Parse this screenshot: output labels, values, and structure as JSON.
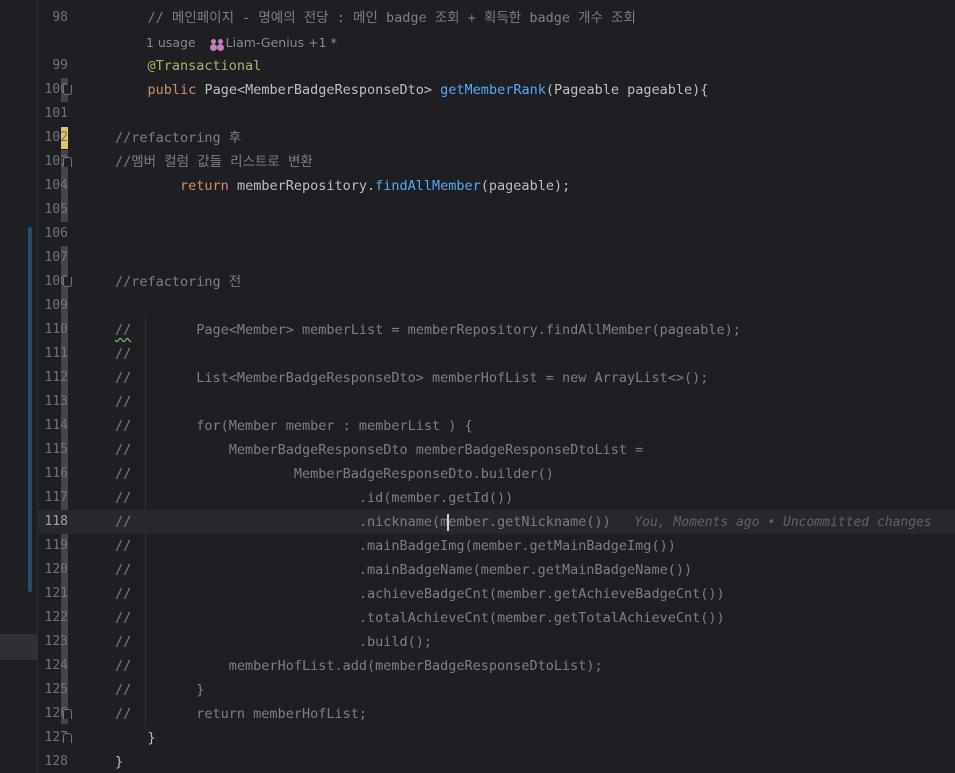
{
  "editor": {
    "lines": [
      {
        "num": "98",
        "text": "    // 메인페이지 - 명예의 전당 : 메인 badge 조회 + 획득한 badge 개수 조회"
      },
      {
        "num": "",
        "hint_usage": "1 usage",
        "hint_author": "Liam-Genius +1 *"
      },
      {
        "num": "99",
        "text": "    @Transactional"
      },
      {
        "num": "100",
        "parts": [
          "    ",
          "public",
          " ",
          "Page",
          "<",
          "MemberBadgeResponseDto",
          "> ",
          "getMemberRank",
          "(",
          "Pageable",
          " pageable){"
        ]
      },
      {
        "num": "101",
        "text": ""
      },
      {
        "num": "102",
        "text": "//refactoring 후"
      },
      {
        "num": "103",
        "text": "//멤버 컬럼 값들 리스트로 변환"
      },
      {
        "num": "104",
        "parts": [
          "        ",
          "return",
          " memberRepository.",
          "findAllMember",
          "(pageable);"
        ]
      },
      {
        "num": "105",
        "text": ""
      },
      {
        "num": "106",
        "text": ""
      },
      {
        "num": "107",
        "text": ""
      },
      {
        "num": "108",
        "text": "//refactoring 전"
      },
      {
        "num": "109",
        "text": ""
      },
      {
        "num": "110",
        "text": "        Page<Member> memberList = memberRepository.findAllMember(pageable);"
      },
      {
        "num": "111",
        "text": ""
      },
      {
        "num": "112",
        "text": "        List<MemberBadgeResponseDto> memberHofList = new ArrayList<>();"
      },
      {
        "num": "113",
        "text": ""
      },
      {
        "num": "114",
        "text": "        for(Member member : memberList ) {"
      },
      {
        "num": "115",
        "text": "            MemberBadgeResponseDto memberBadgeResponseDtoList ="
      },
      {
        "num": "116",
        "text": "                    MemberBadgeResponseDto.builder()"
      },
      {
        "num": "117",
        "text": "                            .id(member.getId())"
      },
      {
        "num": "118",
        "text_before_caret": "                            .nickname(m",
        "text_after_caret": "ember.getNickname())",
        "blame": "   You, Moments ago • Uncommitted changes"
      },
      {
        "num": "119",
        "text": "                            .mainBadgeImg(member.getMainBadgeImg())"
      },
      {
        "num": "120",
        "text": "                            .mainBadgeName(member.getMainBadgeName())"
      },
      {
        "num": "121",
        "text": "                            .achieveBadgeCnt(member.getAchieveBadgeCnt())"
      },
      {
        "num": "122",
        "text": "                            .totalAchieveCnt(member.getTotalAchieveCnt())"
      },
      {
        "num": "123",
        "text": "                            .build();"
      },
      {
        "num": "124",
        "text": "            memberHofList.add(memberBadgeResponseDtoList);"
      },
      {
        "num": "125",
        "text": "        }"
      },
      {
        "num": "126",
        "text": "        return memberHofList;"
      },
      {
        "num": "127",
        "text": "    }"
      },
      {
        "num": "128",
        "text": "}"
      }
    ],
    "comment_prefix": "//",
    "colors": {
      "background": "#1e1f22",
      "current_line": "#26282e",
      "keyword": "#cf8e6d",
      "annotation": "#b3ae60",
      "function": "#56a8f5",
      "comment": "#7a7e85",
      "text": "#bcbec4",
      "line_number": "#6f737a",
      "changed_bar_yellow": "#e0c46c",
      "changed_bar_gray": "#43454a",
      "author_icon": "#c77dba"
    },
    "icons": [
      "fold-marker-icon",
      "users-icon",
      "text-caret"
    ]
  }
}
